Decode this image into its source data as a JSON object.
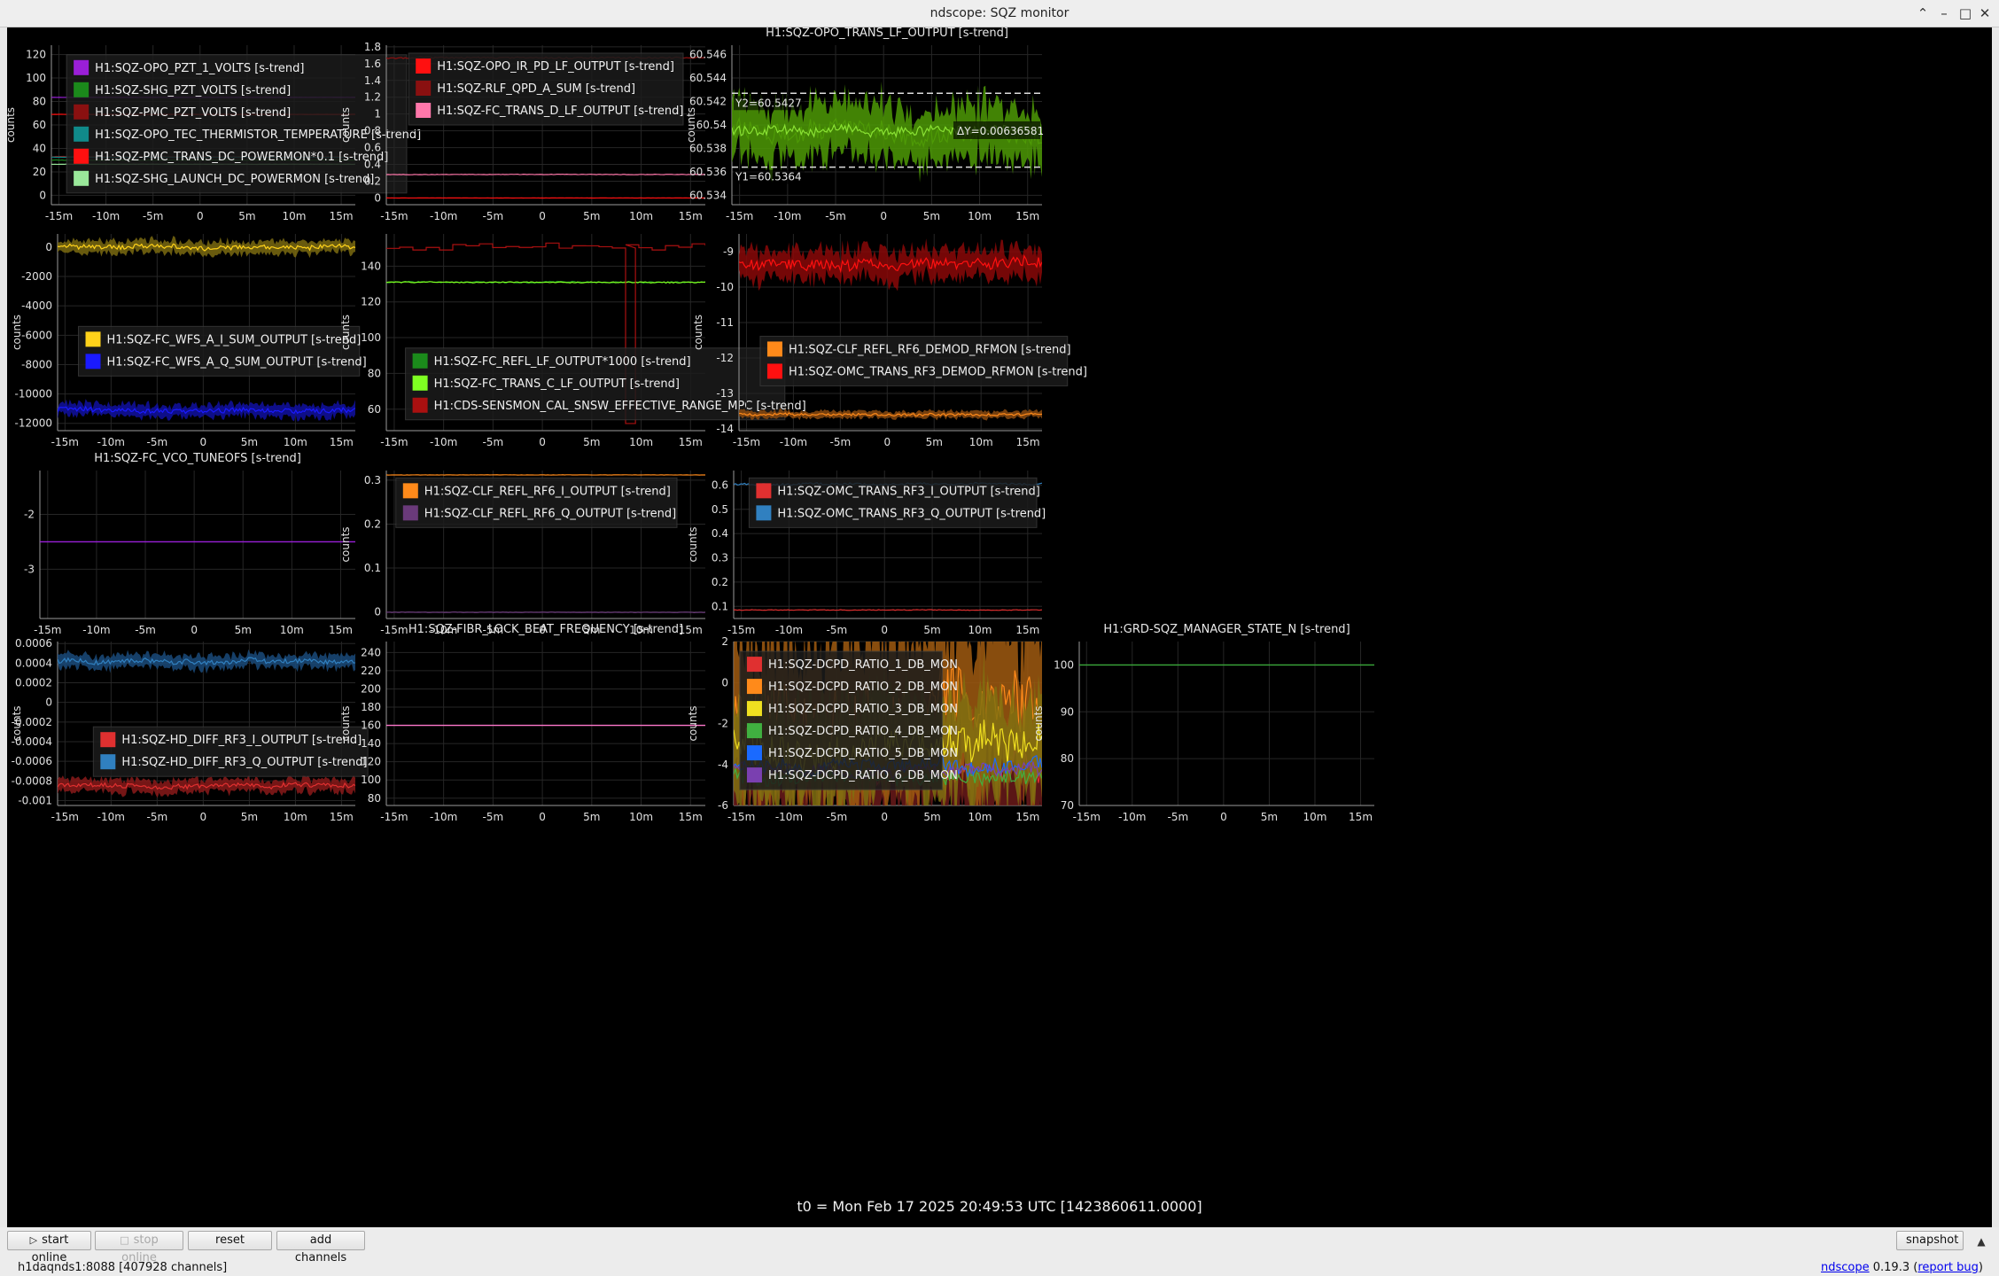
{
  "window": {
    "title": "ndscope: SQZ monitor"
  },
  "t0": "t0 = Mon Feb 17 2025 20:49:53 UTC [1423860611.0000]",
  "ylabel": "counts",
  "toolbar": {
    "start": "start online",
    "stop": "stop online",
    "reset": "reset",
    "add": "add channels",
    "snapshot": "snapshot"
  },
  "status": {
    "server": "h1daqnds1:8088  [407928 channels]",
    "app": "ndscope",
    "version": "0.19.3",
    "report": "report bug"
  },
  "colors": {
    "background": "#000000",
    "grid": "#262626",
    "axis": "#9a9a9a",
    "cursor": "#dddddd"
  },
  "plots": [
    {
      "title": "",
      "yticks": [
        0,
        20,
        40,
        60,
        80,
        100,
        120
      ],
      "ylim": [
        -8,
        128
      ],
      "legend": {
        "x": 0.05,
        "y": 0.06
      },
      "series": [
        {
          "name": "H1:SQZ-OPO_PZT_1_VOLTS [s-trend]",
          "color": "#9a1fd8",
          "value": 83.5,
          "noise": 0.1
        },
        {
          "name": "H1:SQZ-SHG_PZT_VOLTS [s-trend]",
          "color": "#1b8a1b",
          "value": 30,
          "noise": 0.3
        },
        {
          "name": "H1:SQZ-PMC_PZT_VOLTS [s-trend]",
          "color": "#8a1010",
          "value": 33,
          "noise": 0.3
        },
        {
          "name": "H1:SQZ-OPO_TEC_THERMISTOR_TEMPERATURE [s-trend]",
          "color": "#108a8a",
          "value": 32.5,
          "noise": 0.1
        },
        {
          "name": "H1:SQZ-PMC_TRANS_DC_POWERMON*0.1 [s-trend]",
          "color": "#ff1010",
          "value": 69,
          "noise": 0.1
        },
        {
          "name": "H1:SQZ-SHG_LAUNCH_DC_POWERMON [s-trend]",
          "color": "#9ae89a",
          "value": 26.5,
          "noise": 0.1
        }
      ]
    },
    {
      "title": "",
      "yticks": [
        0,
        0.2,
        0.4,
        0.6,
        0.8,
        1,
        1.2,
        1.4,
        1.6,
        1.8
      ],
      "yticklabels": [
        "0",
        "0.2",
        "0.4",
        "0.6",
        "0.8",
        "1",
        "1.2",
        "1.4",
        "1.6",
        "1.8"
      ],
      "ylim": [
        -0.08,
        1.82
      ],
      "legend": {
        "x": 0.07,
        "y": 0.05
      },
      "series": [
        {
          "name": "H1:SQZ-OPO_IR_PD_LF_OUTPUT [s-trend]",
          "color": "#ff1010",
          "value": 0,
          "noise": 0.001
        },
        {
          "name": "H1:SQZ-RLF_QPD_A_SUM [s-trend]",
          "color": "#8a1010",
          "value": 1.67,
          "noise": 0.015
        },
        {
          "name": "H1:SQZ-FC_TRANS_D_LF_OUTPUT [s-trend]",
          "color": "#ff77aa",
          "value": 0.28,
          "noise": 0.004
        }
      ]
    },
    {
      "title": "H1:SQZ-OPO_TRANS_LF_OUTPUT [s-trend]",
      "yticks": [
        60.534,
        60.536,
        60.538,
        60.54,
        60.542,
        60.544,
        60.546
      ],
      "yticklabels": [
        "60.534",
        "60.536",
        "60.538",
        "60.54",
        "60.542",
        "60.544",
        "60.546"
      ],
      "ylim": [
        60.5332,
        60.5468
      ],
      "legend": null,
      "series": [
        {
          "name": "",
          "color": "#4e9a06",
          "value": 60.5395,
          "noise": 0.0014,
          "fill": true
        },
        {
          "name": "",
          "color": "#8ae234",
          "value": 60.5395,
          "noise": 0.0007
        }
      ],
      "cursors": {
        "y1": 60.5364,
        "y2": 60.5427,
        "y1_label": "Y1=60.5364",
        "y2_label": "Y2=60.5427",
        "dy_label": "ΔY=0.00636581"
      }
    },
    {
      "title": "",
      "yticks": [
        -12000,
        -10000,
        -8000,
        -6000,
        -4000,
        -2000,
        0
      ],
      "ylim": [
        -12500,
        900
      ],
      "legend": {
        "x": 0.07,
        "y": 0.47
      },
      "series": [
        {
          "name": "H1:SQZ-FC_WFS_A_I_SUM_OUTPUT [s-trend]",
          "color": "#ffd21a",
          "value": 0,
          "noise": 250,
          "fill": true,
          "fillcolor": "#7a6a10"
        },
        {
          "name": "H1:SQZ-FC_WFS_A_Q_SUM_OUTPUT [s-trend]",
          "color": "#1a1aff",
          "value": -11100,
          "noise": 250,
          "fill": true,
          "fillcolor": "#1010a0"
        }
      ]
    },
    {
      "title": "",
      "yticks": [
        60,
        80,
        100,
        120,
        140
      ],
      "ylim": [
        48,
        158
      ],
      "legend": {
        "x": 0.06,
        "y": 0.58
      },
      "series": [
        {
          "name": "H1:SQZ-FC_REFL_LF_OUTPUT*1000 [s-trend]",
          "color": "#1b8a1b",
          "value": 131,
          "noise": 0.6
        },
        {
          "name": "H1:SQZ-FC_TRANS_C_LF_OUTPUT [s-trend]",
          "color": "#7fff22",
          "value": 131,
          "noise": 0.5
        },
        {
          "name": "H1:CDS-SENSMON_CAL_SNSW_EFFECTIVE_RANGE_MPC [s-trend]",
          "color": "#aa1010",
          "value": 151,
          "step": true
        }
      ]
    },
    {
      "title": "",
      "yticks": [
        -14,
        -13,
        -12,
        -11,
        -10,
        -9
      ],
      "ylim": [
        -14.05,
        -8.5
      ],
      "legend": {
        "x": 0.07,
        "y": 0.52
      },
      "series": [
        {
          "name": "H1:SQZ-CLF_REFL_RF6_DEMOD_RFMON [s-trend]",
          "color": "#ff8a1a",
          "value": -13.6,
          "noise": 0.06,
          "fill": true,
          "fillcolor": "#8a4a10"
        },
        {
          "name": "H1:SQZ-OMC_TRANS_RF3_DEMOD_RFMON [s-trend]",
          "color": "#ff1010",
          "value": -9.35,
          "noise": 0.25,
          "fill": true,
          "fillcolor": "#8a0808"
        }
      ]
    },
    {
      "title": "H1:SQZ-FC_VCO_TUNEOFS [s-trend]",
      "yticks": [
        -3,
        -2
      ],
      "ylim": [
        -3.9,
        -1.2
      ],
      "legend": null,
      "series": [
        {
          "name": "",
          "color": "#9a1fd8",
          "value": -2.5,
          "noise": 0
        }
      ]
    },
    {
      "title": "",
      "yticks": [
        0,
        0.1,
        0.2,
        0.3
      ],
      "yticklabels": [
        "0",
        "0.1",
        "0.2",
        "0.3"
      ],
      "ylim": [
        -0.015,
        0.322
      ],
      "legend": {
        "x": 0.03,
        "y": 0.05
      },
      "series": [
        {
          "name": "H1:SQZ-CLF_REFL_RF6_I_OUTPUT [s-trend]",
          "color": "#ff8a1a",
          "value": 0.312,
          "noise": 0.0005
        },
        {
          "name": "H1:SQZ-CLF_REFL_RF6_Q_OUTPUT [s-trend]",
          "color": "#6a3a7a",
          "value": -0.001,
          "noise": 0.0008
        }
      ]
    },
    {
      "title": "",
      "yticks": [
        0.1,
        0.2,
        0.3,
        0.4,
        0.5,
        0.6
      ],
      "yticklabels": [
        "0.1",
        "0.2",
        "0.3",
        "0.4",
        "0.5",
        "0.6"
      ],
      "ylim": [
        0.05,
        0.66
      ],
      "legend": {
        "x": 0.05,
        "y": 0.05
      },
      "series": [
        {
          "name": "H1:SQZ-OMC_TRANS_RF3_I_OUTPUT [s-trend]",
          "color": "#e03030",
          "value": 0.085,
          "noise": 0.002
        },
        {
          "name": "H1:SQZ-OMC_TRANS_RF3_Q_OUTPUT [s-trend]",
          "color": "#3080c0",
          "value": 0.605,
          "noise": 0.007
        }
      ]
    },
    {
      "title": "",
      "yticks": [
        -0.001,
        -0.0008,
        -0.0006,
        -0.0004,
        -0.0002,
        0,
        0.0002,
        0.0004,
        0.0006
      ],
      "yticklabels": [
        "-0.001",
        "-0.0008",
        "-0.0006",
        "-0.0004",
        "-0.0002",
        "0",
        "0.0002",
        "0.0004",
        "0.0006"
      ],
      "ylim": [
        -0.00105,
        0.00062
      ],
      "legend": {
        "x": 0.12,
        "y": 0.52
      },
      "series": [
        {
          "name": "H1:SQZ-HD_DIFF_RF3_I_OUTPUT [s-trend]",
          "color": "#e03030",
          "value": -0.00085,
          "noise": 4e-05,
          "fill": true,
          "fillcolor": "#8a1a1a"
        },
        {
          "name": "H1:SQZ-HD_DIFF_RF3_Q_OUTPUT [s-trend]",
          "color": "#3080c0",
          "value": 0.00042,
          "noise": 4e-05,
          "fill": true,
          "fillcolor": "#1a4a7a"
        }
      ]
    },
    {
      "title": "H1:SQZ-FIBR_LOCK_BEAT_FREQUENCY [s-trend]",
      "yticks": [
        80,
        100,
        120,
        140,
        160,
        180,
        200,
        220,
        240
      ],
      "ylim": [
        72,
        252
      ],
      "legend": null,
      "series": [
        {
          "name": "",
          "color": "#ff77cc",
          "value": 160,
          "noise": 0
        }
      ]
    },
    {
      "title": "",
      "yticks": [
        -6,
        -4,
        -2,
        0,
        2
      ],
      "ylim": [
        -6,
        2
      ],
      "legend": {
        "x": 0.02,
        "y": 0.06
      },
      "series": [
        {
          "name": "H1:SQZ-DCPD_RATIO_1_DB_MON",
          "color": "#e03030",
          "value": -3.9,
          "noise": 1.4,
          "fill": true,
          "fillcolor": "#6a1a1a"
        },
        {
          "name": "H1:SQZ-DCPD_RATIO_2_DB_MON",
          "color": "#ff8a1a",
          "value": -1.5,
          "noise": 2.2,
          "fill": true,
          "fillcolor": "#a05a10"
        },
        {
          "name": "H1:SQZ-DCPD_RATIO_3_DB_MON",
          "color": "#f0e020",
          "value": -3.2,
          "noise": 1.4,
          "fill": true,
          "fillcolor": "#807010"
        },
        {
          "name": "H1:SQZ-DCPD_RATIO_4_DB_MON",
          "color": "#40b040",
          "value": -4.6,
          "noise": 0.6
        },
        {
          "name": "H1:SQZ-DCPD_RATIO_5_DB_MON",
          "color": "#1a6aff",
          "value": -4.1,
          "noise": 0.6
        },
        {
          "name": "H1:SQZ-DCPD_RATIO_6_DB_MON",
          "color": "#7a40b0",
          "value": -4.3,
          "noise": 0.5
        }
      ]
    },
    {
      "title": "H1:GRD-SQZ_MANAGER_STATE_N [s-trend]",
      "yticks": [
        70,
        80,
        90,
        100
      ],
      "ylim": [
        70,
        105
      ],
      "legend": null,
      "series": [
        {
          "name": "",
          "color": "#3aa83a",
          "value": 100,
          "noise": 0
        }
      ]
    }
  ],
  "xticks": [
    "-15m",
    "-10m",
    "-5m",
    "0",
    "5m",
    "10m",
    "15m"
  ]
}
